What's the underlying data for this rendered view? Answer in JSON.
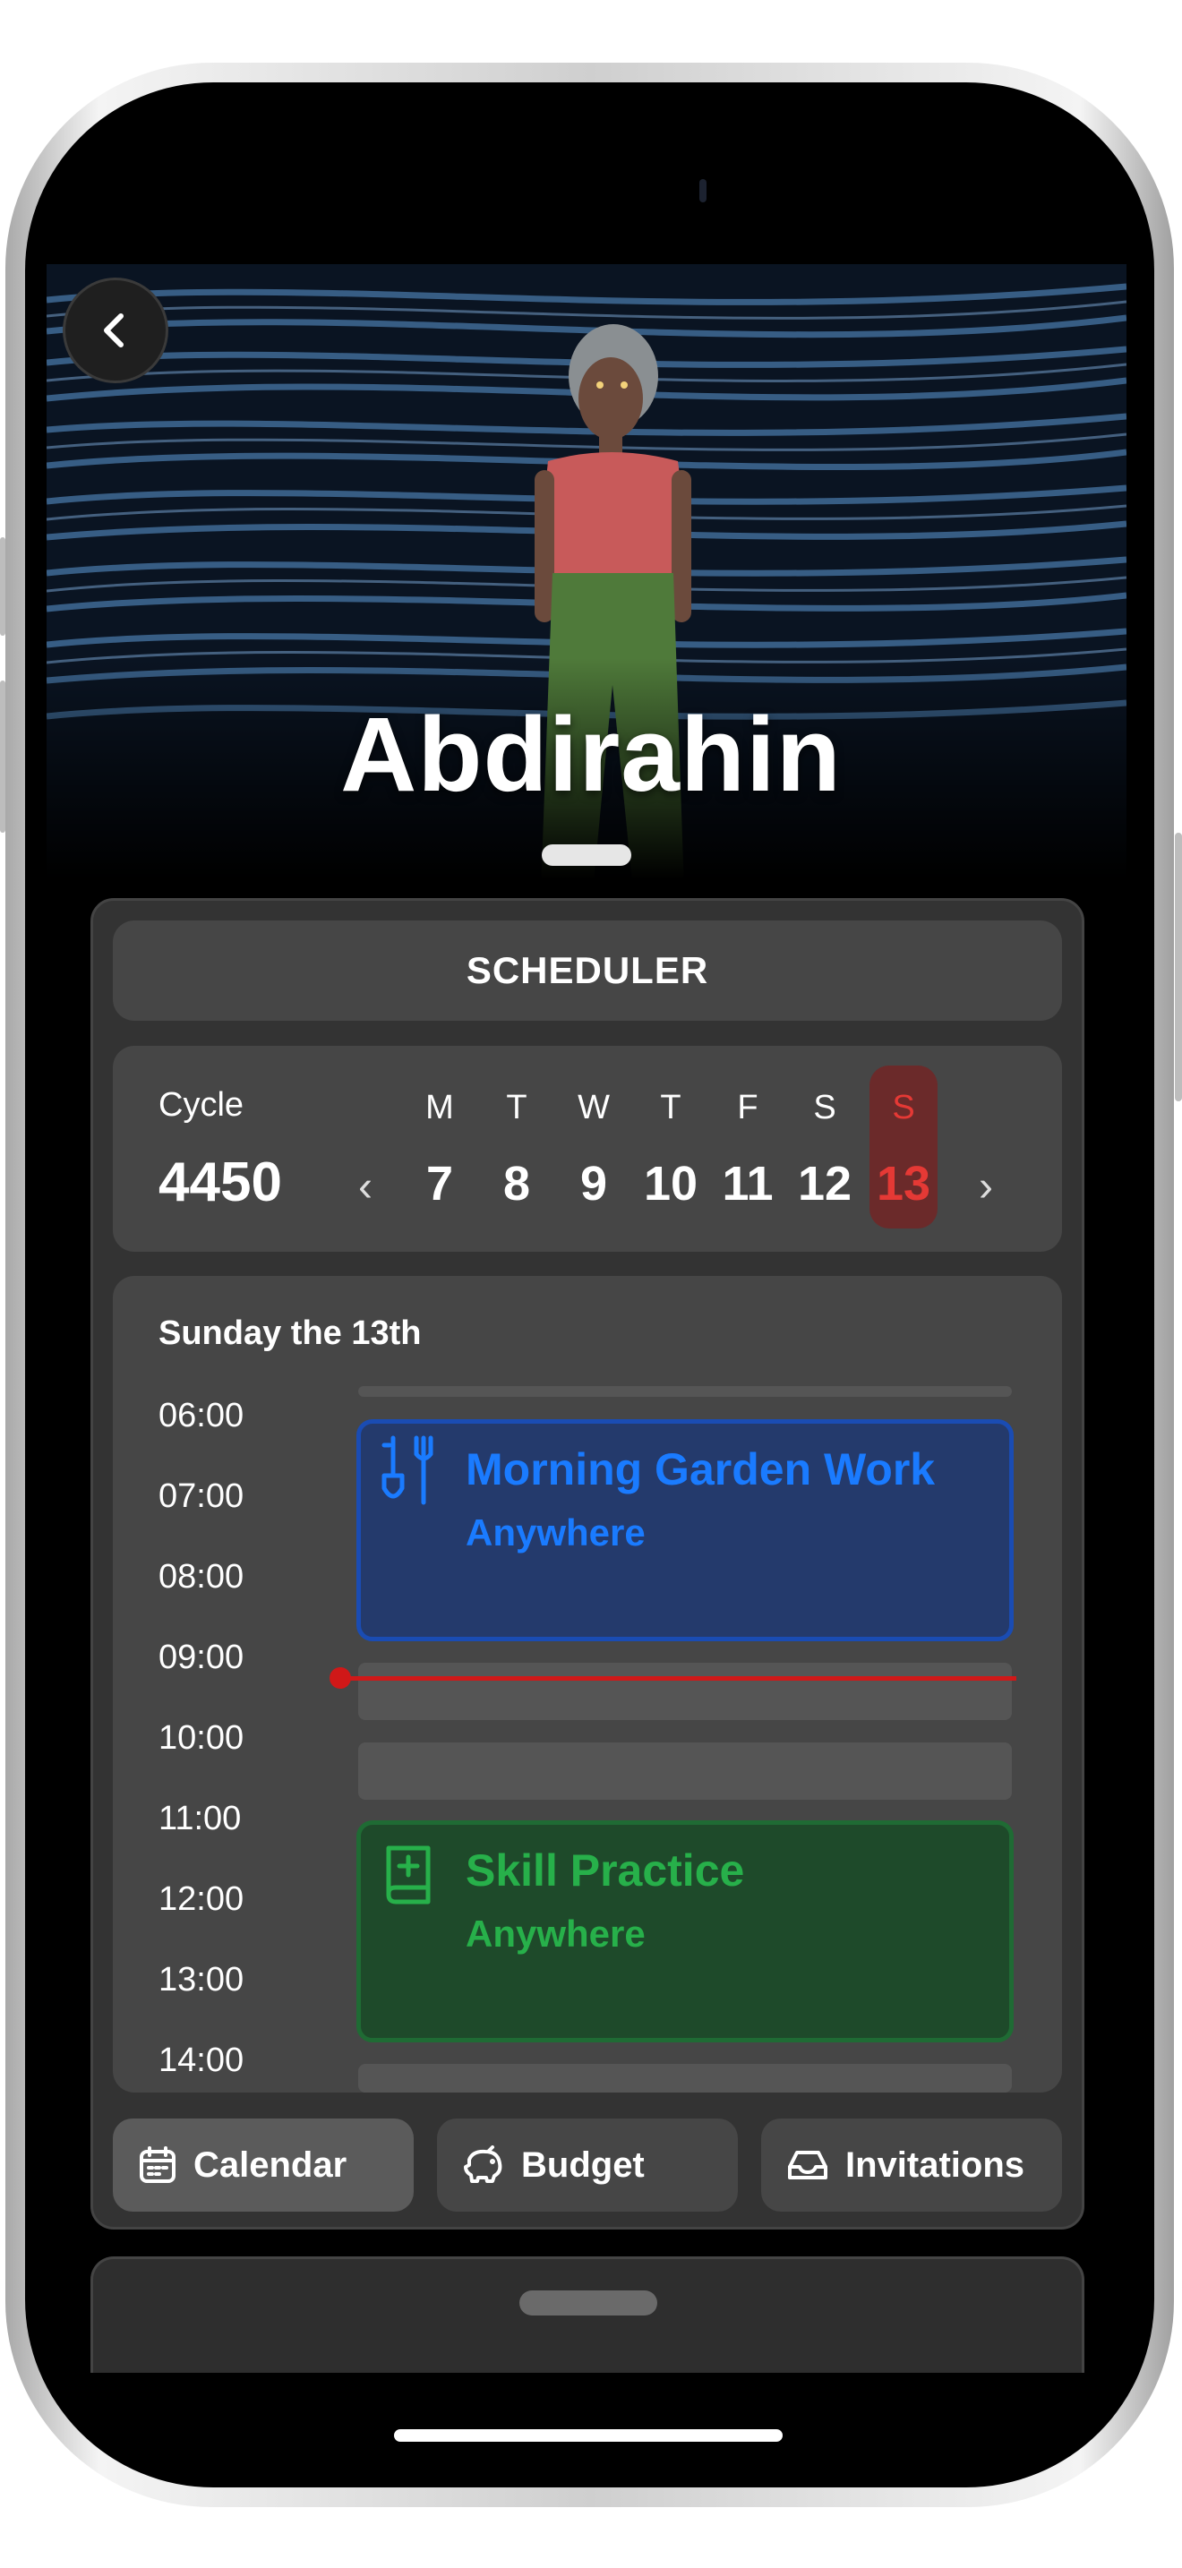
{
  "profile": {
    "name": "Abdirahin"
  },
  "scheduler": {
    "title": "SCHEDULER"
  },
  "week": {
    "cycle_label": "Cycle",
    "cycle_number": "4450",
    "prev": "‹",
    "next": "›",
    "days": [
      {
        "letter": "M",
        "num": "7"
      },
      {
        "letter": "T",
        "num": "8"
      },
      {
        "letter": "W",
        "num": "9"
      },
      {
        "letter": "T",
        "num": "10"
      },
      {
        "letter": "F",
        "num": "11"
      },
      {
        "letter": "S",
        "num": "12"
      },
      {
        "letter": "S",
        "num": "13",
        "selected": true
      }
    ]
  },
  "day": {
    "title": "Sunday the 13th",
    "times": [
      "06:00",
      "07:00",
      "08:00",
      "09:00",
      "10:00",
      "11:00",
      "12:00",
      "13:00",
      "14:00"
    ],
    "events": [
      {
        "title": "Morning Garden Work",
        "location": "Anywhere",
        "icon": "garden-tools-icon",
        "color": "#1a7bff"
      },
      {
        "title": "Skill Practice",
        "location": "Anywhere",
        "icon": "book-plus-icon",
        "color": "#27b04a"
      }
    ]
  },
  "tabs": [
    {
      "label": "Calendar",
      "icon": "calendar-icon",
      "active": true
    },
    {
      "label": "Budget",
      "icon": "piggy-bank-icon"
    },
    {
      "label": "Invitations",
      "icon": "inbox-icon"
    }
  ],
  "colors": {
    "accent_red": "#e53935",
    "event_blue": "#1a7bff",
    "event_green": "#27b04a"
  }
}
